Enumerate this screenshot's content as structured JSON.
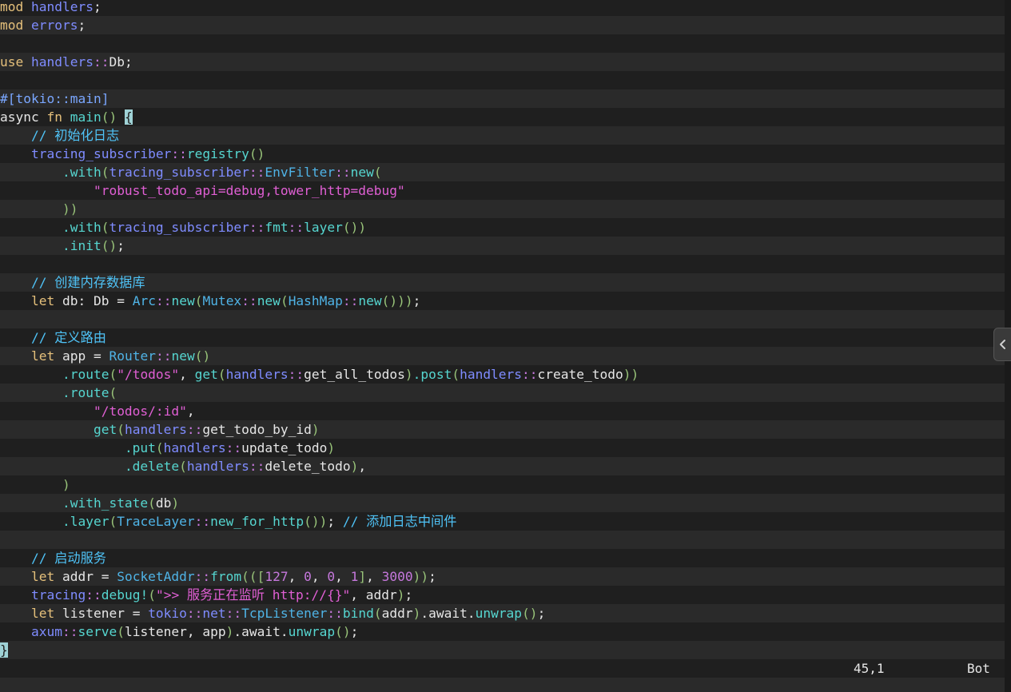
{
  "editor": {
    "lines": [
      [
        [
          "kw",
          "mod"
        ],
        [
          "plain",
          " "
        ],
        [
          "mod",
          "handlers"
        ],
        [
          "plain",
          ";"
        ]
      ],
      [
        [
          "kw",
          "mod"
        ],
        [
          "plain",
          " "
        ],
        [
          "mod",
          "errors"
        ],
        [
          "plain",
          ";"
        ]
      ],
      [],
      [
        [
          "kw",
          "use"
        ],
        [
          "plain",
          " "
        ],
        [
          "mod",
          "handlers"
        ],
        [
          "path",
          "::"
        ],
        [
          "plain",
          "Db;"
        ]
      ],
      [],
      [
        [
          "attr",
          "#[tokio::main]"
        ]
      ],
      [
        [
          "plain",
          "async "
        ],
        [
          "kw",
          "fn"
        ],
        [
          "plain",
          " "
        ],
        [
          "fn",
          "main"
        ],
        [
          "pun",
          "() "
        ],
        [
          "cursor",
          "{"
        ]
      ],
      [
        [
          "plain",
          "    "
        ],
        [
          "cm",
          "// 初始化日志"
        ]
      ],
      [
        [
          "plain",
          "    "
        ],
        [
          "mod",
          "tracing_subscriber"
        ],
        [
          "path",
          "::"
        ],
        [
          "fn",
          "registry"
        ],
        [
          "pun",
          "()"
        ]
      ],
      [
        [
          "plain",
          "        "
        ],
        [
          "fn",
          ".with"
        ],
        [
          "pun",
          "("
        ],
        [
          "mod",
          "tracing_subscriber"
        ],
        [
          "path",
          "::"
        ],
        [
          "ty",
          "EnvFilter"
        ],
        [
          "path",
          "::"
        ],
        [
          "fn",
          "new"
        ],
        [
          "pun",
          "("
        ]
      ],
      [
        [
          "plain",
          "            "
        ],
        [
          "str",
          "\"robust_todo_api=debug,tower_http=debug\""
        ]
      ],
      [
        [
          "plain",
          "        "
        ],
        [
          "pun",
          "))"
        ]
      ],
      [
        [
          "plain",
          "        "
        ],
        [
          "fn",
          ".with"
        ],
        [
          "pun",
          "("
        ],
        [
          "mod",
          "tracing_subscriber"
        ],
        [
          "path",
          "::"
        ],
        [
          "fn",
          "fmt"
        ],
        [
          "path",
          "::"
        ],
        [
          "fn",
          "layer"
        ],
        [
          "pun",
          "())"
        ]
      ],
      [
        [
          "plain",
          "        "
        ],
        [
          "fn",
          ".init"
        ],
        [
          "pun",
          "()"
        ],
        [
          "plain",
          ";"
        ]
      ],
      [],
      [
        [
          "plain",
          "    "
        ],
        [
          "cm",
          "// 创建内存数据库"
        ]
      ],
      [
        [
          "plain",
          "    "
        ],
        [
          "kw",
          "let"
        ],
        [
          "plain",
          " db: Db = "
        ],
        [
          "ty",
          "Arc"
        ],
        [
          "path",
          "::"
        ],
        [
          "fn",
          "new"
        ],
        [
          "pun",
          "("
        ],
        [
          "ty",
          "Mutex"
        ],
        [
          "path",
          "::"
        ],
        [
          "fn",
          "new"
        ],
        [
          "pun",
          "("
        ],
        [
          "ty",
          "HashMap"
        ],
        [
          "path",
          "::"
        ],
        [
          "fn",
          "new"
        ],
        [
          "pun",
          "()))"
        ],
        [
          "plain",
          ";"
        ]
      ],
      [],
      [
        [
          "plain",
          "    "
        ],
        [
          "cm",
          "// 定义路由"
        ]
      ],
      [
        [
          "plain",
          "    "
        ],
        [
          "kw",
          "let"
        ],
        [
          "plain",
          " app = "
        ],
        [
          "ty",
          "Router"
        ],
        [
          "path",
          "::"
        ],
        [
          "fn",
          "new"
        ],
        [
          "pun",
          "()"
        ]
      ],
      [
        [
          "plain",
          "        "
        ],
        [
          "fn",
          ".route"
        ],
        [
          "pun",
          "("
        ],
        [
          "str",
          "\"/todos\""
        ],
        [
          "plain",
          ", "
        ],
        [
          "fn",
          "get"
        ],
        [
          "pun",
          "("
        ],
        [
          "mod",
          "handlers"
        ],
        [
          "path",
          "::"
        ],
        [
          "plain",
          "get_all_todos"
        ],
        [
          "pun",
          ")"
        ],
        [
          "fn",
          ".post"
        ],
        [
          "pun",
          "("
        ],
        [
          "mod",
          "handlers"
        ],
        [
          "path",
          "::"
        ],
        [
          "plain",
          "create_todo"
        ],
        [
          "pun",
          "))"
        ]
      ],
      [
        [
          "plain",
          "        "
        ],
        [
          "fn",
          ".route"
        ],
        [
          "pun",
          "("
        ]
      ],
      [
        [
          "plain",
          "            "
        ],
        [
          "str",
          "\"/todos/:id\""
        ],
        [
          "plain",
          ","
        ]
      ],
      [
        [
          "plain",
          "            "
        ],
        [
          "fn",
          "get"
        ],
        [
          "pun",
          "("
        ],
        [
          "mod",
          "handlers"
        ],
        [
          "path",
          "::"
        ],
        [
          "plain",
          "get_todo_by_id"
        ],
        [
          "pun",
          ")"
        ]
      ],
      [
        [
          "plain",
          "                "
        ],
        [
          "fn",
          ".put"
        ],
        [
          "pun",
          "("
        ],
        [
          "mod",
          "handlers"
        ],
        [
          "path",
          "::"
        ],
        [
          "plain",
          "update_todo"
        ],
        [
          "pun",
          ")"
        ]
      ],
      [
        [
          "plain",
          "                "
        ],
        [
          "fn",
          ".delete"
        ],
        [
          "pun",
          "("
        ],
        [
          "mod",
          "handlers"
        ],
        [
          "path",
          "::"
        ],
        [
          "plain",
          "delete_todo"
        ],
        [
          "pun",
          ")"
        ],
        [
          "plain",
          ","
        ]
      ],
      [
        [
          "plain",
          "        "
        ],
        [
          "pun",
          ")"
        ]
      ],
      [
        [
          "plain",
          "        "
        ],
        [
          "fn",
          ".with_state"
        ],
        [
          "pun",
          "("
        ],
        [
          "plain",
          "db"
        ],
        [
          "pun",
          ")"
        ]
      ],
      [
        [
          "plain",
          "        "
        ],
        [
          "fn",
          ".layer"
        ],
        [
          "pun",
          "("
        ],
        [
          "ty",
          "TraceLayer"
        ],
        [
          "path",
          "::"
        ],
        [
          "fn",
          "new_for_http"
        ],
        [
          "pun",
          "())"
        ],
        [
          "plain",
          "; "
        ],
        [
          "cm",
          "// 添加日志中间件"
        ]
      ],
      [],
      [
        [
          "plain",
          "    "
        ],
        [
          "cm",
          "// 启动服务"
        ]
      ],
      [
        [
          "plain",
          "    "
        ],
        [
          "kw",
          "let"
        ],
        [
          "plain",
          " addr = "
        ],
        [
          "ty",
          "SocketAddr"
        ],
        [
          "path",
          "::"
        ],
        [
          "fn",
          "from"
        ],
        [
          "pun",
          "(("
        ],
        [
          "pun",
          "["
        ],
        [
          "num",
          "127"
        ],
        [
          "plain",
          ", "
        ],
        [
          "num",
          "0"
        ],
        [
          "plain",
          ", "
        ],
        [
          "num",
          "0"
        ],
        [
          "plain",
          ", "
        ],
        [
          "num",
          "1"
        ],
        [
          "pun",
          "]"
        ],
        [
          "plain",
          ", "
        ],
        [
          "num",
          "3000"
        ],
        [
          "pun",
          "))"
        ],
        [
          "plain",
          ";"
        ]
      ],
      [
        [
          "plain",
          "    "
        ],
        [
          "mod",
          "tracing"
        ],
        [
          "path",
          "::"
        ],
        [
          "fn",
          "debug!"
        ],
        [
          "pun",
          "("
        ],
        [
          "str",
          "\">> 服务正在监听 http://{}\""
        ],
        [
          "plain",
          ", addr"
        ],
        [
          "pun",
          ")"
        ],
        [
          "plain",
          ";"
        ]
      ],
      [
        [
          "plain",
          "    "
        ],
        [
          "kw",
          "let"
        ],
        [
          "plain",
          " listener = "
        ],
        [
          "mod",
          "tokio"
        ],
        [
          "path",
          "::"
        ],
        [
          "mod",
          "net"
        ],
        [
          "path",
          "::"
        ],
        [
          "ty",
          "TcpListener"
        ],
        [
          "path",
          "::"
        ],
        [
          "fn",
          "bind"
        ],
        [
          "pun",
          "("
        ],
        [
          "plain",
          "addr"
        ],
        [
          "pun",
          ")"
        ],
        [
          "plain",
          ".await."
        ],
        [
          "fn",
          "unwrap"
        ],
        [
          "pun",
          "()"
        ],
        [
          "plain",
          ";"
        ]
      ],
      [
        [
          "plain",
          "    "
        ],
        [
          "mod",
          "axum"
        ],
        [
          "path",
          "::"
        ],
        [
          "fn",
          "serve"
        ],
        [
          "pun",
          "("
        ],
        [
          "plain",
          "listener, app"
        ],
        [
          "pun",
          ")"
        ],
        [
          "plain",
          ".await."
        ],
        [
          "fn",
          "unwrap"
        ],
        [
          "pun",
          "()"
        ],
        [
          "plain",
          ";"
        ]
      ],
      [
        [
          "cursor",
          "}"
        ]
      ]
    ]
  },
  "status": {
    "position": "45,1",
    "scroll": "Bot"
  },
  "sidebar_toggle": {
    "icon": "chevron-left-icon"
  },
  "colors": {
    "background": "#1e1e1e",
    "keyword": "#e5c07b",
    "module": "#7f8cff",
    "string": "#e05fd4",
    "comment": "#4fc3f7",
    "function": "#56d6d0"
  }
}
